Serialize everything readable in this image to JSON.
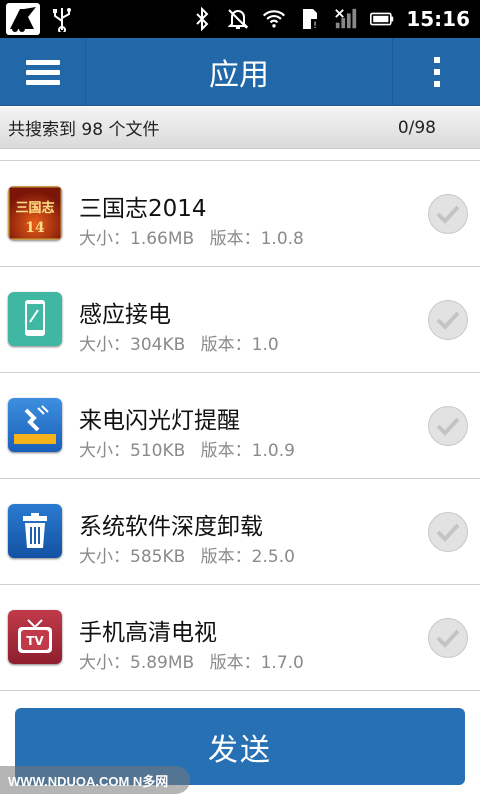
{
  "status_bar": {
    "time": "15:16",
    "icons": [
      "app-notification-icon",
      "usb-icon",
      "bluetooth-icon",
      "muted-bell-icon",
      "wifi-icon",
      "sd-card-icon",
      "signal-icon",
      "battery-icon"
    ]
  },
  "header": {
    "title": "应用",
    "menu_icon": "hamburger-menu-icon",
    "more_icon": "overflow-menu-icon",
    "color": "#2268a8"
  },
  "summary": {
    "found_text": "共搜索到 98 个文件",
    "selection_count": "0/98"
  },
  "apps": [
    {
      "name": "三国志2014",
      "size": "大小：1.66MB",
      "version": "版本：1.0.8",
      "icon": "three-kingdoms-game-icon",
      "selected": false
    },
    {
      "name": "感应接电",
      "size": "大小：304KB",
      "version": "版本：1.0",
      "icon": "phone-sensor-icon",
      "selected": false
    },
    {
      "name": "来电闪光灯提醒",
      "size": "大小：510KB",
      "version": "版本：1.0.9",
      "icon": "flash-alert-icon",
      "selected": false
    },
    {
      "name": "系统软件深度卸载",
      "size": "大小：585KB",
      "version": "版本：2.5.0",
      "icon": "trash-icon",
      "selected": false
    },
    {
      "name": "手机高清电视",
      "size": "大小：5.89MB",
      "version": "版本：1.7.0",
      "icon": "tv-icon",
      "selected": false
    }
  ],
  "send_button": {
    "label": "发送",
    "color": "#2670b3"
  },
  "watermark": "WWW.NDUOA.COM N多网"
}
